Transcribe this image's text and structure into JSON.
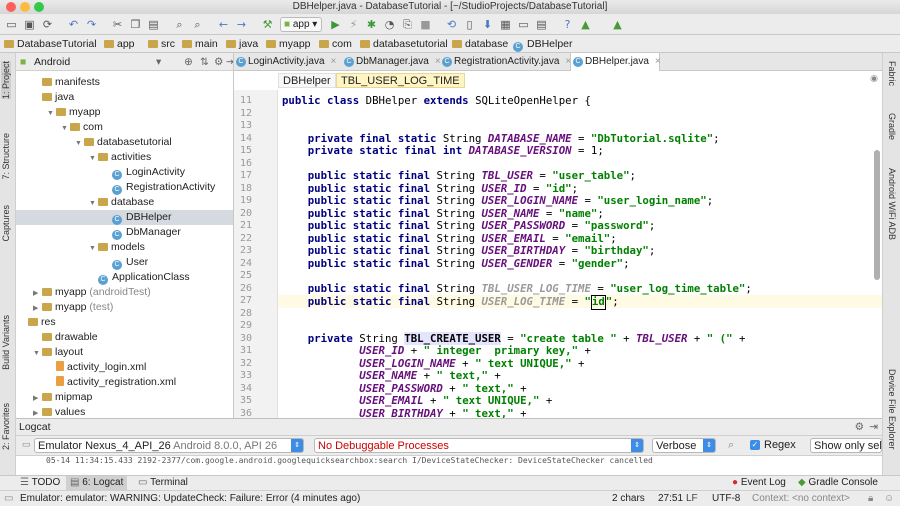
{
  "window": {
    "title": "DBHelper.java - DatabaseTutorial - [~/StudioProjects/DatabaseTutorial]"
  },
  "toolbar": {
    "run_config": "app"
  },
  "navbar": {
    "crumbs": [
      "DatabaseTutorial",
      "app",
      "src",
      "main",
      "java",
      "myapp",
      "com",
      "databasetutorial",
      "database",
      "DBHelper"
    ]
  },
  "left_strip": {
    "items": [
      "1: Project",
      "7: Structure",
      "Captures",
      "Build Variants",
      "2: Favorites"
    ]
  },
  "right_strip": {
    "items": [
      "Fabric",
      "Gradle",
      "Android WiFi ADB",
      "Device File Explorer"
    ]
  },
  "project": {
    "view": "Android",
    "tree": [
      {
        "label": "manifests",
        "indent": 0,
        "kind": "folder",
        "arrow": ""
      },
      {
        "label": "java",
        "indent": 0,
        "kind": "folder",
        "arrow": ""
      },
      {
        "label": "myapp",
        "indent": 1,
        "kind": "folder",
        "arrow": "▼"
      },
      {
        "label": "com",
        "indent": 2,
        "kind": "folder",
        "arrow": "▼"
      },
      {
        "label": "databasetutorial",
        "indent": 3,
        "kind": "folder",
        "arrow": "▼"
      },
      {
        "label": "activities",
        "indent": 4,
        "kind": "folder",
        "arrow": "▼"
      },
      {
        "label": "LoginActivity",
        "indent": 5,
        "kind": "class",
        "arrow": ""
      },
      {
        "label": "RegistrationActivity",
        "indent": 5,
        "kind": "class",
        "arrow": ""
      },
      {
        "label": "database",
        "indent": 4,
        "kind": "folder",
        "arrow": "▼"
      },
      {
        "label": "DBHelper",
        "indent": 5,
        "kind": "class",
        "arrow": "",
        "selected": true
      },
      {
        "label": "DbManager",
        "indent": 5,
        "kind": "class",
        "arrow": ""
      },
      {
        "label": "models",
        "indent": 4,
        "kind": "folder",
        "arrow": "▼"
      },
      {
        "label": "User",
        "indent": 5,
        "kind": "class",
        "arrow": ""
      },
      {
        "label": "ApplicationClass",
        "indent": 4,
        "kind": "class",
        "arrow": ""
      },
      {
        "label": "myapp",
        "suffix": "(androidTest)",
        "indent": 0,
        "kind": "folder",
        "arrow": "▶"
      },
      {
        "label": "myapp",
        "suffix": "(test)",
        "indent": 0,
        "kind": "folder",
        "arrow": "▶"
      },
      {
        "label": "res",
        "indent": -1,
        "kind": "folder",
        "arrow": ""
      },
      {
        "label": "drawable",
        "indent": 0,
        "kind": "folder",
        "arrow": ""
      },
      {
        "label": "layout",
        "indent": 0,
        "kind": "folder",
        "arrow": "▼"
      },
      {
        "label": "activity_login.xml",
        "indent": 1,
        "kind": "xml",
        "arrow": ""
      },
      {
        "label": "activity_registration.xml",
        "indent": 1,
        "kind": "xml",
        "arrow": ""
      },
      {
        "label": "mipmap",
        "indent": 0,
        "kind": "folder",
        "arrow": "▶"
      },
      {
        "label": "values",
        "indent": 0,
        "kind": "folder",
        "arrow": "▶"
      }
    ]
  },
  "tabs": [
    {
      "label": "LoginActivity.java",
      "active": false
    },
    {
      "label": "DbManager.java",
      "active": false
    },
    {
      "label": "RegistrationActivity.java",
      "active": false
    },
    {
      "label": "DBHelper.java",
      "active": true
    }
  ],
  "editor_breadcrumbs": [
    "DBHelper",
    "TBL_USER_LOG_TIME"
  ],
  "code": [
    {
      "n": 11,
      "t": [
        [
          "kw",
          "public class "
        ],
        [
          "",
          "DBHelper "
        ],
        [
          "kw",
          "extends "
        ],
        [
          "",
          "SQLiteOpenHelper {"
        ]
      ]
    },
    {
      "n": 12,
      "t": []
    },
    {
      "n": 13,
      "t": []
    },
    {
      "n": 14,
      "t": [
        [
          "",
          "    "
        ],
        [
          "kw",
          "private final static "
        ],
        [
          "",
          "String "
        ],
        [
          "fi",
          "DATABASE_NAME"
        ],
        [
          "",
          " = "
        ],
        [
          "st",
          "\"DbTutorial.sqlite\""
        ],
        [
          "",
          ";"
        ]
      ]
    },
    {
      "n": 15,
      "t": [
        [
          "",
          "    "
        ],
        [
          "kw",
          "private static final int "
        ],
        [
          "fi",
          "DATABASE_VERSION"
        ],
        [
          "",
          " = "
        ],
        [
          "",
          "1;"
        ]
      ]
    },
    {
      "n": 16,
      "t": []
    },
    {
      "n": 17,
      "t": [
        [
          "",
          "    "
        ],
        [
          "kw",
          "public static final "
        ],
        [
          "",
          "String "
        ],
        [
          "fi",
          "TBL_USER"
        ],
        [
          "",
          " = "
        ],
        [
          "st",
          "\"user_table\""
        ],
        [
          "",
          ";"
        ]
      ]
    },
    {
      "n": 18,
      "t": [
        [
          "",
          "    "
        ],
        [
          "kw",
          "public static final "
        ],
        [
          "",
          "String "
        ],
        [
          "fi",
          "USER_ID"
        ],
        [
          "",
          " = "
        ],
        [
          "st",
          "\"id\""
        ],
        [
          "",
          ";"
        ]
      ]
    },
    {
      "n": 19,
      "t": [
        [
          "",
          "    "
        ],
        [
          "kw",
          "public static final "
        ],
        [
          "",
          "String "
        ],
        [
          "fi",
          "USER_LOGIN_NAME"
        ],
        [
          "",
          " = "
        ],
        [
          "st",
          "\"user_login_name\""
        ],
        [
          "",
          ";"
        ]
      ]
    },
    {
      "n": 20,
      "t": [
        [
          "",
          "    "
        ],
        [
          "kw",
          "public static final "
        ],
        [
          "",
          "String "
        ],
        [
          "fi",
          "USER_NAME"
        ],
        [
          "",
          " = "
        ],
        [
          "st",
          "\"name\""
        ],
        [
          "",
          ";"
        ]
      ]
    },
    {
      "n": 21,
      "t": [
        [
          "",
          "    "
        ],
        [
          "kw",
          "public static final "
        ],
        [
          "",
          "String "
        ],
        [
          "fi",
          "USER_PASSWORD"
        ],
        [
          "",
          " = "
        ],
        [
          "st",
          "\"password\""
        ],
        [
          "",
          ";"
        ]
      ]
    },
    {
      "n": 22,
      "t": [
        [
          "",
          "    "
        ],
        [
          "kw",
          "public static final "
        ],
        [
          "",
          "String "
        ],
        [
          "fi",
          "USER_EMAIL"
        ],
        [
          "",
          " = "
        ],
        [
          "st",
          "\"email\""
        ],
        [
          "",
          ";"
        ]
      ]
    },
    {
      "n": 23,
      "t": [
        [
          "",
          "    "
        ],
        [
          "kw",
          "public static final "
        ],
        [
          "",
          "String "
        ],
        [
          "fi",
          "USER_BIRTHDAY"
        ],
        [
          "",
          " = "
        ],
        [
          "st",
          "\"birthday\""
        ],
        [
          "",
          ";"
        ]
      ]
    },
    {
      "n": 24,
      "t": [
        [
          "",
          "    "
        ],
        [
          "kw",
          "public static final "
        ],
        [
          "",
          "String "
        ],
        [
          "fi",
          "USER_GENDER"
        ],
        [
          "",
          " = "
        ],
        [
          "st",
          "\"gender\""
        ],
        [
          "",
          ";"
        ]
      ]
    },
    {
      "n": 25,
      "t": []
    },
    {
      "n": 26,
      "t": [
        [
          "",
          "    "
        ],
        [
          "kw",
          "public static final "
        ],
        [
          "",
          "String "
        ],
        [
          "fu",
          "TBL_USER_LOG_TIME"
        ],
        [
          "",
          " = "
        ],
        [
          "st",
          "\"user_log_time_table\""
        ],
        [
          "",
          ";"
        ]
      ]
    },
    {
      "n": 27,
      "t": [
        [
          "",
          "    "
        ],
        [
          "kw",
          "public static final "
        ],
        [
          "",
          "String "
        ],
        [
          "fu",
          "USER_LOG_TIME"
        ],
        [
          "",
          " = "
        ],
        [
          "st",
          "\""
        ],
        [
          "caret",
          "id"
        ],
        [
          "st",
          "\""
        ],
        [
          "",
          ";"
        ]
      ],
      "current": true
    },
    {
      "n": 28,
      "t": []
    },
    {
      "n": 29,
      "t": []
    },
    {
      "n": 30,
      "t": [
        [
          "",
          "    "
        ],
        [
          "kw",
          "private "
        ],
        [
          "",
          "String "
        ],
        [
          "hl",
          "TBL_CREATE_USER"
        ],
        [
          "",
          " = "
        ],
        [
          "st",
          "\"create table \""
        ],
        [
          "",
          " + "
        ],
        [
          "fi",
          "TBL_USER"
        ],
        [
          "",
          " + "
        ],
        [
          "st",
          "\" (\""
        ],
        [
          "",
          " +"
        ]
      ]
    },
    {
      "n": 31,
      "t": [
        [
          "",
          "            "
        ],
        [
          "fi",
          "USER_ID"
        ],
        [
          "",
          " + "
        ],
        [
          "st",
          "\" integer  primary key,\""
        ],
        [
          "",
          " +"
        ]
      ]
    },
    {
      "n": 32,
      "t": [
        [
          "",
          "            "
        ],
        [
          "fi",
          "USER_LOGIN_NAME"
        ],
        [
          "",
          " + "
        ],
        [
          "st",
          "\" text UNIQUE,\""
        ],
        [
          "",
          " +"
        ]
      ]
    },
    {
      "n": 33,
      "t": [
        [
          "",
          "            "
        ],
        [
          "fi",
          "USER_NAME"
        ],
        [
          "",
          " + "
        ],
        [
          "st",
          "\" text,\""
        ],
        [
          "",
          " +"
        ]
      ]
    },
    {
      "n": 34,
      "t": [
        [
          "",
          "            "
        ],
        [
          "fi",
          "USER_PASSWORD"
        ],
        [
          "",
          " + "
        ],
        [
          "st",
          "\" text,\""
        ],
        [
          "",
          " +"
        ]
      ]
    },
    {
      "n": 35,
      "t": [
        [
          "",
          "            "
        ],
        [
          "fi",
          "USER_EMAIL"
        ],
        [
          "",
          " + "
        ],
        [
          "st",
          "\" text UNIQUE,\""
        ],
        [
          "",
          " +"
        ]
      ]
    },
    {
      "n": 36,
      "t": [
        [
          "",
          "            "
        ],
        [
          "fi",
          "USER_BIRTHDAY"
        ],
        [
          "",
          " + "
        ],
        [
          "st",
          "\" text,\""
        ],
        [
          "",
          " +"
        ]
      ]
    }
  ],
  "logcat": {
    "title": "Logcat",
    "device": "Emulator Nexus_4_API_26",
    "device_detail": "Android 8.0.0, API 26",
    "process": "No Debuggable Processes",
    "level": "Verbose",
    "regex_label": "Regex",
    "show_only": "Show only selected application",
    "log_line": "05-14 11:34:15.433 2192-2377/com.google.android.googlequicksearchbox:search I/DeviceStateChecker: DeviceStateChecker cancelled"
  },
  "bottom_tabs": {
    "todo": "TODO",
    "logcat": "6: Logcat",
    "terminal": "Terminal",
    "event_log": "Event Log",
    "gradle_console": "Gradle Console"
  },
  "status": {
    "message": "Emulator: emulator: WARNING: UpdateCheck: Failure: Error (4 minutes ago)",
    "selection": "2 chars",
    "position": "27:51",
    "encoding": "UTF-8",
    "context": "Context: <no context>"
  },
  "colors": {
    "keyword": "#000080",
    "field": "#660e7a",
    "string": "#008000",
    "accent": "#3d8ce6"
  }
}
